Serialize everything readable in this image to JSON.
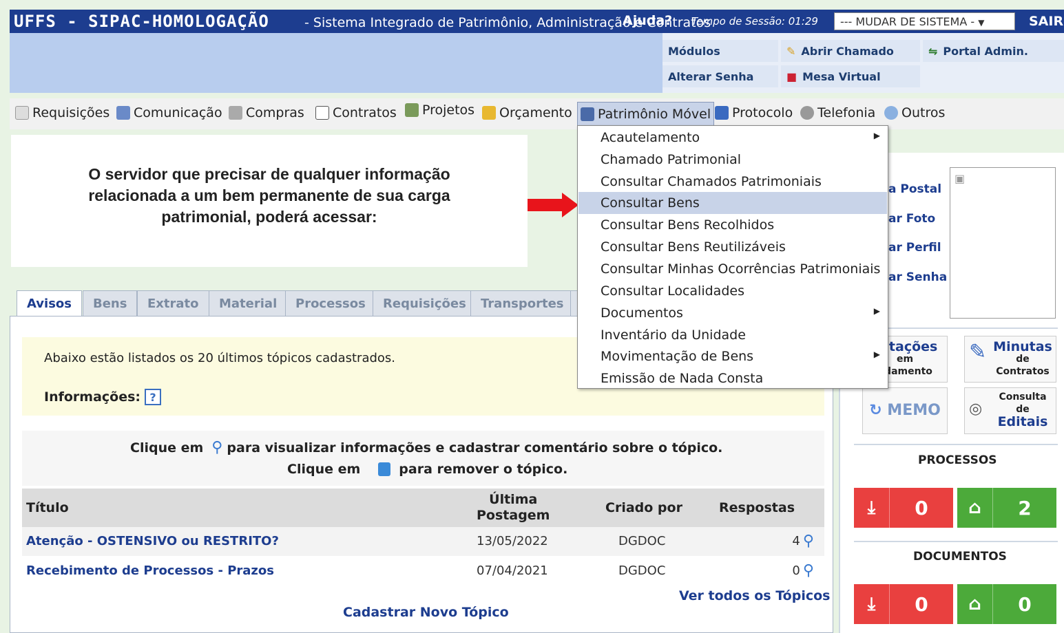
{
  "topbar": {
    "app_title": "UFFS - SIPAC-HOMOLOGAÇÃO",
    "subtitle": "- Sistema Integrado de Patrimônio, Administração e Contratos",
    "help": "Ajuda?",
    "session_timer": "Tempo de Sessão: 01:29",
    "system_select": "--- MUDAR DE SISTEMA -",
    "exit": "SAIR"
  },
  "header_links": {
    "modules": "Módulos",
    "open_ticket": "Abrir Chamado",
    "admin_portal": "Portal Admin.",
    "change_password": "Alterar Senha",
    "virtual_desk": "Mesa Virtual"
  },
  "menu": [
    {
      "label": "Requisições",
      "icon": "document-icon"
    },
    {
      "label": "Comunicação",
      "icon": "book-icon"
    },
    {
      "label": "Compras",
      "icon": "cart-icon"
    },
    {
      "label": "Contratos",
      "icon": "page-icon"
    },
    {
      "label": "Projetos",
      "icon": "wrench-icon"
    },
    {
      "label": "Orçamento",
      "icon": "budget-icon"
    },
    {
      "label": "Patrimônio Móvel",
      "icon": "monitor-icon"
    },
    {
      "label": "Protocolo",
      "icon": "protocol-icon"
    },
    {
      "label": "Telefonia",
      "icon": "phone-icon"
    },
    {
      "label": "Outros",
      "icon": "magnifier-icon"
    }
  ],
  "note": {
    "line1": "O servidor que precisar de qualquer  informação",
    "line2": "relacionada a um bem permanente de sua carga",
    "line3": "patrimonial,  poderá acessar:"
  },
  "dropdown": [
    {
      "label": "Acautelamento",
      "submenu": true
    },
    {
      "label": "Chamado Patrimonial",
      "submenu": false
    },
    {
      "label": "Consultar Chamados Patrimoniais",
      "submenu": false
    },
    {
      "label": "Consultar Bens",
      "submenu": false
    },
    {
      "label": "Consultar Bens Recolhidos",
      "submenu": false
    },
    {
      "label": "Consultar Bens Reutilizáveis",
      "submenu": false
    },
    {
      "label": "Consultar Minhas Ocorrências Patrimoniais",
      "submenu": false
    },
    {
      "label": "Consultar Localidades",
      "submenu": false
    },
    {
      "label": "Documentos",
      "submenu": true
    },
    {
      "label": "Inventário da Unidade",
      "submenu": false
    },
    {
      "label": "Movimentação de Bens",
      "submenu": true
    },
    {
      "label": "Emissão de Nada Consta",
      "submenu": false
    }
  ],
  "tabs": [
    "Avisos",
    "Bens",
    "Extrato",
    "Material",
    "Processos",
    "Requisições",
    "Transportes"
  ],
  "notices": {
    "intro": "Abaixo estão listados os 20 últimos tópicos cadastrados.",
    "info_label": "Informações:",
    "click_view_a": "Clique em",
    "click_view_b": "para visualizar informações e cadastrar comentário sobre o tópico.",
    "click_remove_a": "Clique em",
    "click_remove_b": "para remover o tópico.",
    "columns": {
      "title": "Título",
      "last_post_1": "Última",
      "last_post_2": "Postagem",
      "created_by": "Criado por",
      "replies": "Respostas"
    },
    "rows": [
      {
        "title": "Atenção - OSTENSIVO ou RESTRITO?",
        "date": "13/05/2022",
        "author": "DGDOC",
        "replies": "4"
      },
      {
        "title": "Recebimento de Processos - Prazos",
        "date": "07/04/2021",
        "author": "DGDOC",
        "replies": "0"
      }
    ],
    "see_all": "Ver todos os Tópicos",
    "new_topic": "Cadastrar Novo Tópico"
  },
  "sidebar": {
    "links": [
      "a Postal",
      "ar Foto",
      "ar Perfil",
      "ar Senha"
    ],
    "solicitacoes_1": "icitações",
    "solicitacoes_2": "em",
    "solicitacoes_3": "ndamento",
    "minutas_1": "Minutas",
    "minutas_2": "de",
    "minutas_3": "Contratos",
    "memo": "MEMO",
    "consulta_1": "Consulta",
    "consulta_2": "de",
    "consulta_3": "Editais",
    "processos_title": "PROCESSOS",
    "processos_in": "0",
    "processos_home": "2",
    "documentos_title": "DOCUMENTOS",
    "documentos_in": "0",
    "documentos_home": "0"
  },
  "colors": {
    "topbar": "#1d3d8f",
    "red": "#e9403f",
    "green": "#4caa3a",
    "arrow": "#e8141b"
  }
}
